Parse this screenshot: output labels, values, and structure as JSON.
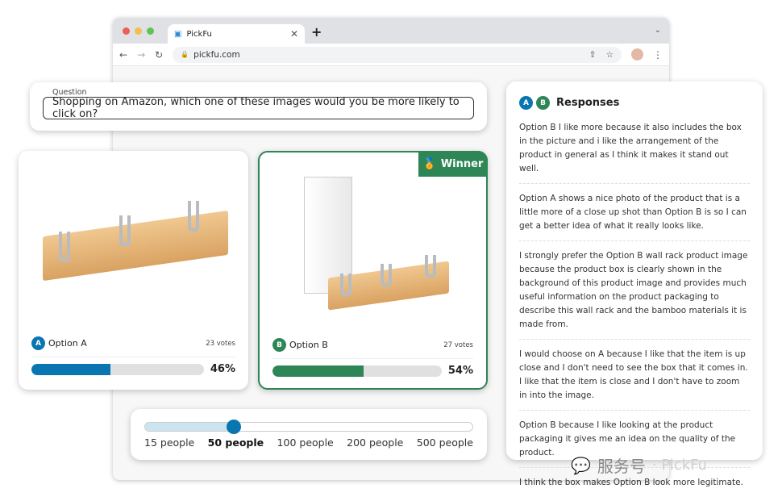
{
  "browser": {
    "tab_title": "PickFu",
    "url": "pickfu.com"
  },
  "question": {
    "label": "Question",
    "text": "Shopping on Amazon, which one of these images would you be more likely to click on?"
  },
  "options": [
    {
      "letter": "A",
      "label": "Option A",
      "votes": "23 votes",
      "percent": "46%",
      "fill": 46,
      "color": "#0a76b1"
    },
    {
      "letter": "B",
      "label": "Option B",
      "votes": "27 votes",
      "percent": "54%",
      "fill": 54,
      "color": "#2e8555",
      "winner_label": "Winner"
    }
  ],
  "slider": {
    "labels": [
      "15 people",
      "50 people",
      "100 people",
      "200 people",
      "500 people"
    ],
    "selected_index": 1
  },
  "responses": {
    "title": "Responses",
    "items": [
      "Option B I like more because it also includes the box in the picture and i like the arrangement of the product in general as I think it makes it stand out well.",
      "Option A shows a nice photo of the product that is a little more of a close up shot than Option B is so I can get a better idea of what it really looks like.",
      "I strongly prefer the Option B wall rack product image because the product box is clearly shown in the background of this product image and provides much useful information on the product packaging to describe this wall rack and the bamboo materials it is made from.",
      "I would choose on A because I like that the item is up close and I don't need to see the box that it comes in. I like that the item is close and I don't have to zoom in into the image.",
      "Option B because I like looking at the product packaging it gives me an idea on the quality of the product.",
      "I think the box makes Option B look more legitimate."
    ]
  },
  "watermark": {
    "text": "服务号",
    "brand": "· PickFu"
  }
}
